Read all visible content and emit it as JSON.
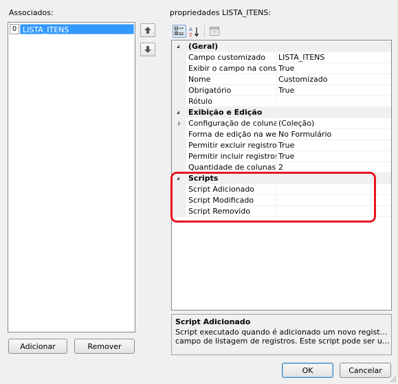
{
  "left": {
    "label": "Associados:",
    "items": [
      {
        "index": "0",
        "name": "LISTA_ITENS"
      }
    ],
    "add_label": "Adicionar",
    "remove_label": "Remover"
  },
  "properties": {
    "label": "propriedades LISTA_ITENS:",
    "categories": [
      {
        "name": "(Geral)",
        "rows": [
          {
            "name": "Campo customizado",
            "value": "LISTA_ITENS"
          },
          {
            "name": "Exibir o campo na consulta",
            "value": "True"
          },
          {
            "name": "Nome",
            "value": "Customizado"
          },
          {
            "name": "Obrigatório",
            "value": "True"
          },
          {
            "name": "Rótulo",
            "value": ""
          }
        ]
      },
      {
        "name": "Exibição e Edição",
        "rows": [
          {
            "name": "Configuração de colunas",
            "value": "(Coleção)"
          },
          {
            "name": "Forma de edição na web",
            "value": "No Formulário"
          },
          {
            "name": "Permitir excluir registros",
            "value": "True"
          },
          {
            "name": "Permitir incluir registros",
            "value": "True"
          },
          {
            "name": "Quantidade de colunas no",
            "value": "2"
          }
        ]
      },
      {
        "name": "Scripts",
        "rows": [
          {
            "name": "Script Adicionado",
            "value": ""
          },
          {
            "name": "Script Modificado",
            "value": ""
          },
          {
            "name": "Script Removido",
            "value": ""
          }
        ]
      }
    ],
    "description": {
      "title": "Script Adicionado",
      "line1": "Script executado quando é adicionado um novo registro em um",
      "line2": "campo de listagem de registros. Este script pode ser utilizado pa..."
    }
  },
  "footer": {
    "ok_label": "OK",
    "cancel_label": "Cancelar"
  },
  "colors": {
    "selection": "#3399ff",
    "highlight": "#e8141e"
  }
}
